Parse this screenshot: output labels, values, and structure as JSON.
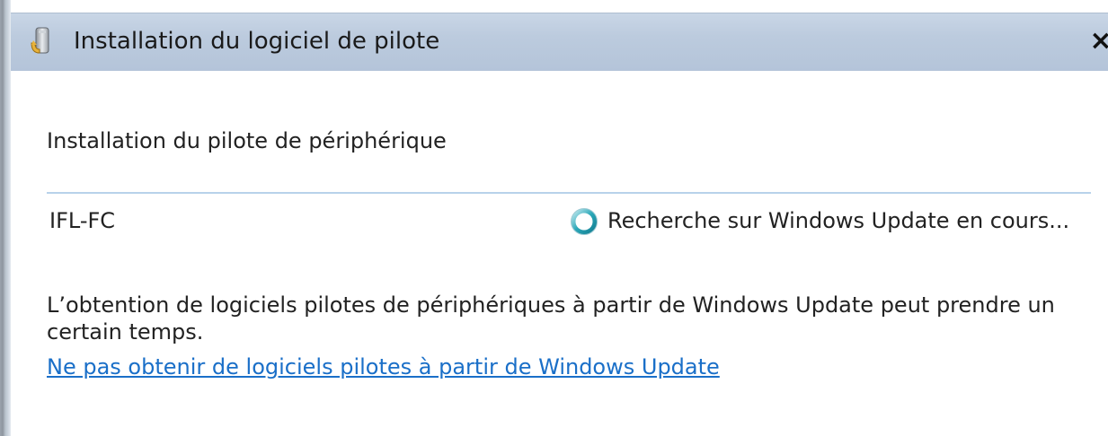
{
  "window": {
    "title": "Installation du logiciel de pilote",
    "close_label": "×"
  },
  "main": {
    "heading": "Installation du pilote de périphérique",
    "device": {
      "name": "IFL-FC",
      "status": "Recherche sur Windows Update en cours..."
    },
    "info": "L’obtention de logiciels pilotes de périphériques à partir de Windows Update peut prendre un certain temps.",
    "skip_link": "Ne pas obtenir de logiciels pilotes à partir de Windows Update"
  },
  "icons": {
    "title": "driver-install-icon",
    "status": "spinner-icon"
  },
  "colors": {
    "titlebar": "#bccbde",
    "link": "#1a6fc8",
    "divider": "#b8d2ea",
    "spinner": "#2aa7b8"
  }
}
